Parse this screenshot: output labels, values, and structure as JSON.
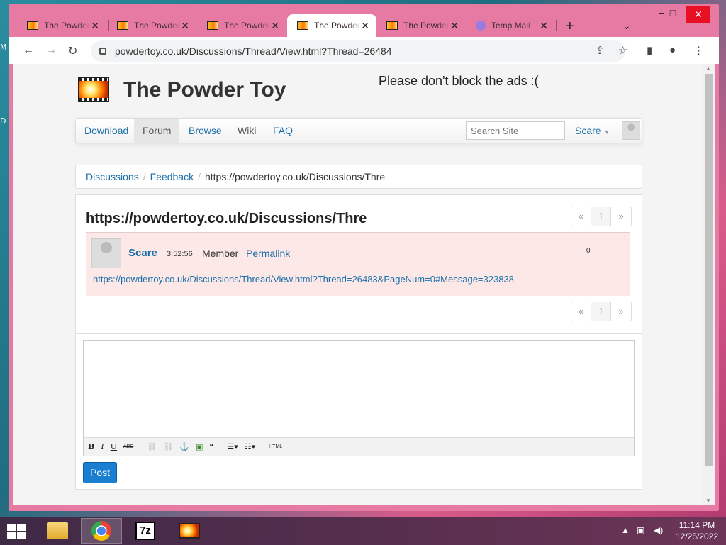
{
  "desktop": {
    "edge_labels": [
      "M",
      "D"
    ]
  },
  "browser": {
    "tabs": [
      {
        "title": "The Powder Toy"
      },
      {
        "title": "The Powder Toy"
      },
      {
        "title": "The Powder Toy"
      },
      {
        "title": "The Powder Toy",
        "active": true
      },
      {
        "title": "The Powder Toy"
      },
      {
        "title": "Temp Mail"
      }
    ],
    "new_tab_icon": "+",
    "tab_list_icon": "⌄",
    "window_controls": {
      "minimize": "–",
      "maximize": "□",
      "close": "✕"
    },
    "address": "powdertoy.co.uk/Discussions/Thread/View.html?Thread=26484"
  },
  "site": {
    "title": "The Powder Toy",
    "ad_message": "Please don't block the ads :(",
    "nav": {
      "items": [
        "Download",
        "Forum",
        "Browse",
        "Wiki",
        "FAQ"
      ],
      "search_placeholder": "Search Site",
      "user": "Scare"
    },
    "breadcrumb": {
      "items": [
        "Discussions",
        "Feedback"
      ],
      "current": "https://powdertoy.co.uk/Discussions/Thre"
    },
    "thread": {
      "title": "https://powdertoy.co.uk/Discussions/Thre",
      "pager": {
        "prev": "«",
        "page": "1",
        "next": "»"
      },
      "post": {
        "author": "Scare",
        "time": "3:52:56",
        "rank": "Member",
        "permalink": "Permalink",
        "score": "0",
        "body": "https://powdertoy.co.uk/Discussions/Thread/View.html?Thread=26483&PageNum=0#Message=323838"
      }
    },
    "editor": {
      "toolbar": [
        "B",
        "I",
        "U",
        "ABC",
        "HTML"
      ],
      "post_button": "Post"
    }
  },
  "taskbar": {
    "clock_time": "11:14 PM",
    "clock_date": "12/25/2022"
  }
}
